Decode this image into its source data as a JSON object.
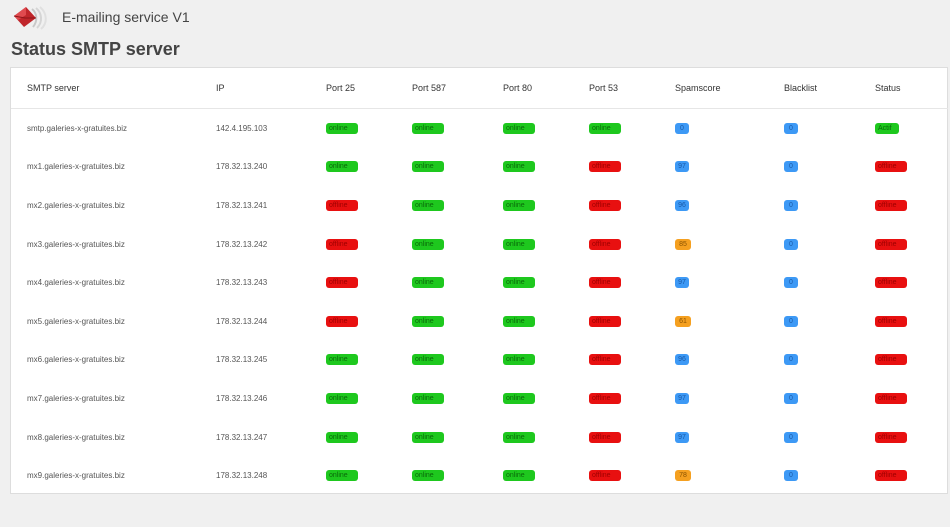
{
  "app": {
    "title": "E-mailing service V1",
    "logo_icon": "mail-envelope-icon"
  },
  "page": {
    "title": "Status SMTP server"
  },
  "colors": {
    "online": "#1ec81e",
    "offline": "#e81010",
    "spamscore_ok": "#3d99f5",
    "spamscore_warn": "#f5a020",
    "blacklist": "#3d99f5"
  },
  "table": {
    "headers": [
      "SMTP server",
      "IP",
      "Port 25",
      "Port 587",
      "Port 80",
      "Port 53",
      "Spamscore",
      "Blacklist",
      "Status"
    ],
    "rows": [
      {
        "server": "smtp.galeries-x-gratuites.biz",
        "ip": "142.4.195.103",
        "port25": "online",
        "port587": "online",
        "port80": "online",
        "port53": "online",
        "spamscore": "0",
        "spam_level": "ok",
        "blacklist": "0",
        "status": "Actif"
      },
      {
        "server": "mx1.galeries-x-gratuites.biz",
        "ip": "178.32.13.240",
        "port25": "online",
        "port587": "online",
        "port80": "online",
        "port53": "offline",
        "spamscore": "97",
        "spam_level": "ok",
        "blacklist": "0",
        "status": "offline"
      },
      {
        "server": "mx2.galeries-x-gratuites.biz",
        "ip": "178.32.13.241",
        "port25": "offline",
        "port587": "online",
        "port80": "online",
        "port53": "offline",
        "spamscore": "96",
        "spam_level": "ok",
        "blacklist": "0",
        "status": "offline"
      },
      {
        "server": "mx3.galeries-x-gratuites.biz",
        "ip": "178.32.13.242",
        "port25": "offline",
        "port587": "online",
        "port80": "online",
        "port53": "offline",
        "spamscore": "85",
        "spam_level": "warn",
        "blacklist": "0",
        "status": "offline"
      },
      {
        "server": "mx4.galeries-x-gratuites.biz",
        "ip": "178.32.13.243",
        "port25": "offline",
        "port587": "online",
        "port80": "online",
        "port53": "offline",
        "spamscore": "97",
        "spam_level": "ok",
        "blacklist": "0",
        "status": "offline"
      },
      {
        "server": "mx5.galeries-x-gratuites.biz",
        "ip": "178.32.13.244",
        "port25": "offline",
        "port587": "online",
        "port80": "online",
        "port53": "offline",
        "spamscore": "61",
        "spam_level": "warn",
        "blacklist": "0",
        "status": "offline"
      },
      {
        "server": "mx6.galeries-x-gratuites.biz",
        "ip": "178.32.13.245",
        "port25": "online",
        "port587": "online",
        "port80": "online",
        "port53": "offline",
        "spamscore": "96",
        "spam_level": "ok",
        "blacklist": "0",
        "status": "offline"
      },
      {
        "server": "mx7.galeries-x-gratuites.biz",
        "ip": "178.32.13.246",
        "port25": "online",
        "port587": "online",
        "port80": "online",
        "port53": "offline",
        "spamscore": "97",
        "spam_level": "ok",
        "blacklist": "0",
        "status": "offline"
      },
      {
        "server": "mx8.galeries-x-gratuites.biz",
        "ip": "178.32.13.247",
        "port25": "online",
        "port587": "online",
        "port80": "online",
        "port53": "offline",
        "spamscore": "97",
        "spam_level": "ok",
        "blacklist": "0",
        "status": "offline"
      },
      {
        "server": "mx9.galeries-x-gratuites.biz",
        "ip": "178.32.13.248",
        "port25": "online",
        "port587": "online",
        "port80": "online",
        "port53": "offline",
        "spamscore": "78",
        "spam_level": "warn",
        "blacklist": "0",
        "status": "offline"
      }
    ]
  }
}
